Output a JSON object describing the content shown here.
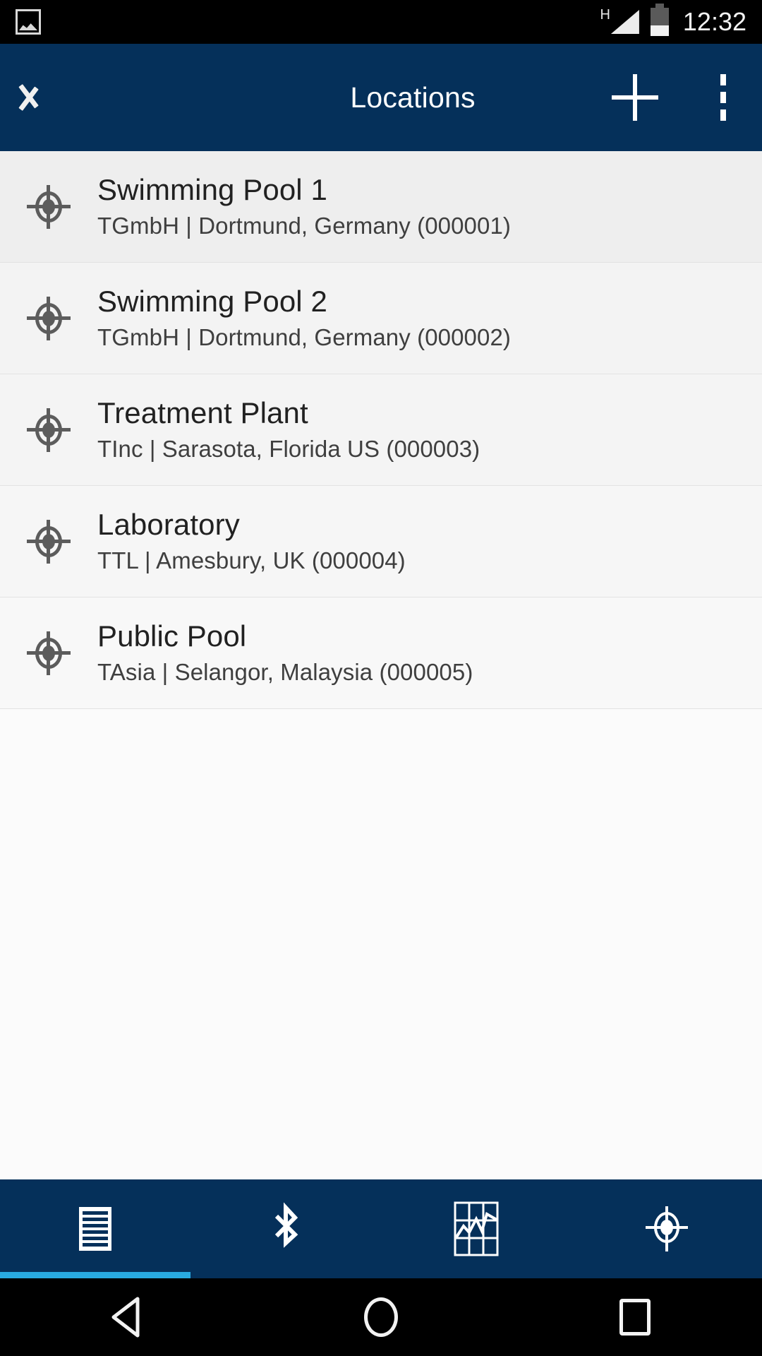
{
  "status_bar": {
    "gallery_icon": "gallery-icon",
    "network_type": "H",
    "signal_icon": "signal-triangle-icon",
    "battery_icon": "battery-icon",
    "time": "12:32"
  },
  "app_bar": {
    "back_icon": "chevron-left-icon",
    "title": "Locations",
    "add_icon": "plus-icon",
    "overflow_icon": "more-vertical-icon"
  },
  "locations": [
    {
      "icon": "crosshair-location-icon",
      "title": "Swimming Pool 1",
      "subtitle": "TGmbH | Dortmund, Germany (000001)",
      "org": "TGmbH",
      "city": "Dortmund",
      "region": "Germany",
      "id": "000001"
    },
    {
      "icon": "crosshair-location-icon",
      "title": "Swimming Pool 2",
      "subtitle": "TGmbH | Dortmund, Germany (000002)",
      "org": "TGmbH",
      "city": "Dortmund",
      "region": "Germany",
      "id": "000002"
    },
    {
      "icon": "crosshair-location-icon",
      "title": "Treatment Plant",
      "subtitle": "TInc | Sarasota, Florida US (000003)",
      "org": "TInc",
      "city": "Sarasota",
      "region": "Florida US",
      "id": "000003"
    },
    {
      "icon": "crosshair-location-icon",
      "title": "Laboratory",
      "subtitle": "TTL | Amesbury, UK (000004)",
      "org": "TTL",
      "city": "Amesbury",
      "region": "UK",
      "id": "000004"
    },
    {
      "icon": "crosshair-location-icon",
      "title": "Public Pool",
      "subtitle": "TAsia | Selangor, Malaysia (000005)",
      "org": "TAsia",
      "city": "Selangor",
      "region": "Malaysia",
      "id": "000005"
    }
  ],
  "bottom_nav": {
    "active_index": 0,
    "tabs": [
      {
        "icon": "list-icon",
        "active": true
      },
      {
        "icon": "bluetooth-icon",
        "active": false
      },
      {
        "icon": "chart-grid-icon",
        "active": false
      },
      {
        "icon": "crosshair-location-icon",
        "active": false
      }
    ]
  },
  "system_nav": {
    "back_icon": "system-back-triangle-icon",
    "home_icon": "system-home-circle-icon",
    "recents_icon": "system-recents-square-icon"
  },
  "colors": {
    "app_bar": "#05305a",
    "accent": "#29abe2",
    "status_bar": "#000000",
    "list_background": "#f3f3f3",
    "icon_gray": "#5c5c5c",
    "title_text": "#212121"
  }
}
